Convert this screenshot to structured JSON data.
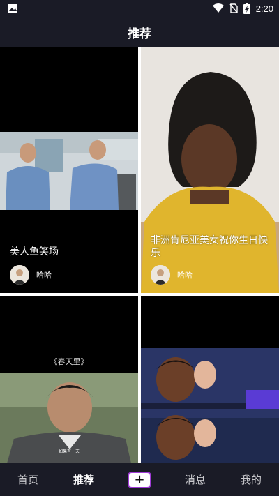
{
  "statusbar": {
    "time": "2:20",
    "icons": [
      "image-icon",
      "wifi-icon",
      "no-sim-icon",
      "battery-charging-icon"
    ]
  },
  "header": {
    "title": "推荐"
  },
  "feed": {
    "cards": [
      {
        "title": "美人鱼笑场",
        "author": "哈哈"
      },
      {
        "title": "非洲肯尼亚美女祝你生日快乐",
        "author": "哈哈"
      },
      {
        "caption_top": "《春天里》",
        "caption_bottom": "如果有一天"
      },
      {}
    ]
  },
  "bottomnav": {
    "items": [
      {
        "label": "首页",
        "active": false
      },
      {
        "label": "推荐",
        "active": true
      },
      {
        "label": "+",
        "icon": "plus-icon"
      },
      {
        "label": "消息",
        "active": false
      },
      {
        "label": "我的",
        "active": false
      }
    ],
    "accent": "#a03bd6"
  },
  "colors": {
    "background": "#1a1b26",
    "grid_gap": "#ffffff"
  }
}
